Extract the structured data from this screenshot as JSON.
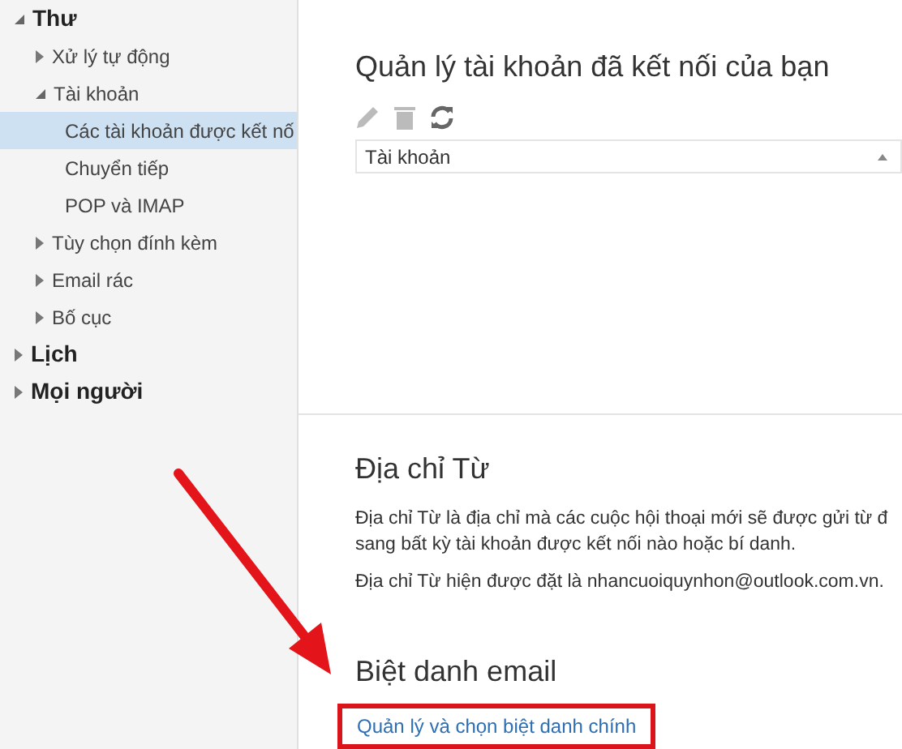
{
  "sidebar": {
    "items": [
      {
        "label": "Thư",
        "expanded": true,
        "selected": false,
        "children": [
          {
            "label": "Xử lý tự động",
            "expanded": false,
            "selected": false
          },
          {
            "label": "Tài khoản",
            "expanded": true,
            "selected": false,
            "children": [
              {
                "label": "Các tài khoản được kết nố",
                "selected": true
              },
              {
                "label": "Chuyển tiếp",
                "selected": false
              },
              {
                "label": "POP và IMAP",
                "selected": false
              }
            ]
          },
          {
            "label": "Tùy chọn đính kèm",
            "expanded": false,
            "selected": false
          },
          {
            "label": "Email rác",
            "expanded": false,
            "selected": false
          },
          {
            "label": "Bố cục",
            "expanded": false,
            "selected": false
          }
        ]
      },
      {
        "label": "Lịch",
        "expanded": false,
        "selected": false
      },
      {
        "label": "Mọi người",
        "expanded": false,
        "selected": false
      }
    ]
  },
  "connected_accounts": {
    "title": "Quản lý tài khoản đã kết nối của bạn",
    "table": {
      "columns": [
        {
          "label": "Tài khoản",
          "sorted_ascending": true
        }
      ]
    }
  },
  "from_address": {
    "title": "Địa chỉ Từ",
    "description": "Địa chỉ Từ là địa chỉ mà các cuộc hội thoại mới sẽ được gửi từ đ sang bất kỳ tài khoản được kết nối nào hoặc bí danh.",
    "current": "Địa chỉ Từ hiện được đặt là nhancuoiquynhon@outlook.com.vn."
  },
  "email_alias": {
    "title": "Biệt danh email",
    "link": "Quản lý và chọn biệt danh chính",
    "highlighted": true
  }
}
